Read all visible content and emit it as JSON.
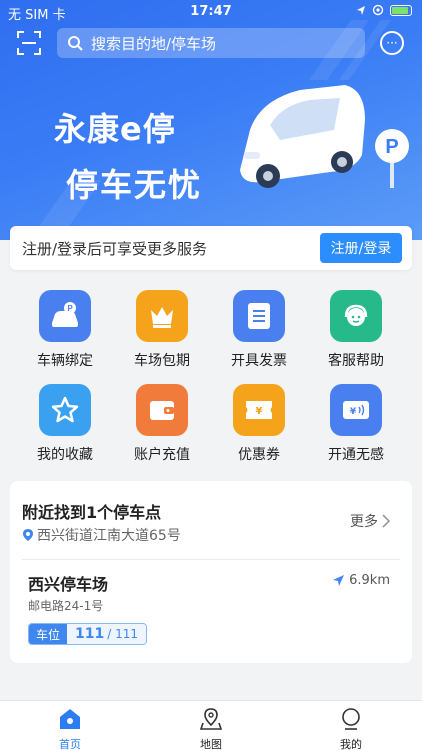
{
  "status": {
    "carrier": "无 SIM 卡",
    "time": "17:47"
  },
  "search": {
    "placeholder": "搜索目的地/停车场"
  },
  "banner": {
    "slogan_line1": "永康e停",
    "slogan_line2": "停车无忧",
    "sign_letter": "P"
  },
  "login": {
    "text": "注册/登录后可享受更多服务",
    "button": "注册/登录"
  },
  "grid": [
    {
      "label": "车辆绑定",
      "icon": "car-bind-icon",
      "color": "#4a7ff0"
    },
    {
      "label": "车场包期",
      "icon": "crown-icon",
      "color": "#f5a31a"
    },
    {
      "label": "开具发票",
      "icon": "invoice-icon",
      "color": "#4a7ff0"
    },
    {
      "label": "客服帮助",
      "icon": "headset-icon",
      "color": "#26b98a"
    },
    {
      "label": "我的收藏",
      "icon": "star-icon",
      "color": "#3aa0f0"
    },
    {
      "label": "账户充值",
      "icon": "wallet-icon",
      "color": "#f07b3a"
    },
    {
      "label": "优惠券",
      "icon": "coupon-icon",
      "color": "#f5a31a"
    },
    {
      "label": "开通无感",
      "icon": "card-icon",
      "color": "#4a7ff0"
    }
  ],
  "nearby": {
    "title": "附近找到1个停车点",
    "address": "西兴街道江南大道65号",
    "more": "更多",
    "lot": {
      "name": "西兴停车场",
      "road": "邮电路24-1号",
      "distance": "6.9km",
      "spot_tag": "车位",
      "spot_free": "111",
      "spot_total": "/ 111"
    }
  },
  "tabs": [
    {
      "label": "首页",
      "icon": "home-icon",
      "active": true
    },
    {
      "label": "地图",
      "icon": "map-icon",
      "active": false
    },
    {
      "label": "我的",
      "icon": "profile-icon",
      "active": false
    }
  ],
  "colors": {
    "primary": "#2c7ef0",
    "banner": "#3a7cf5"
  }
}
